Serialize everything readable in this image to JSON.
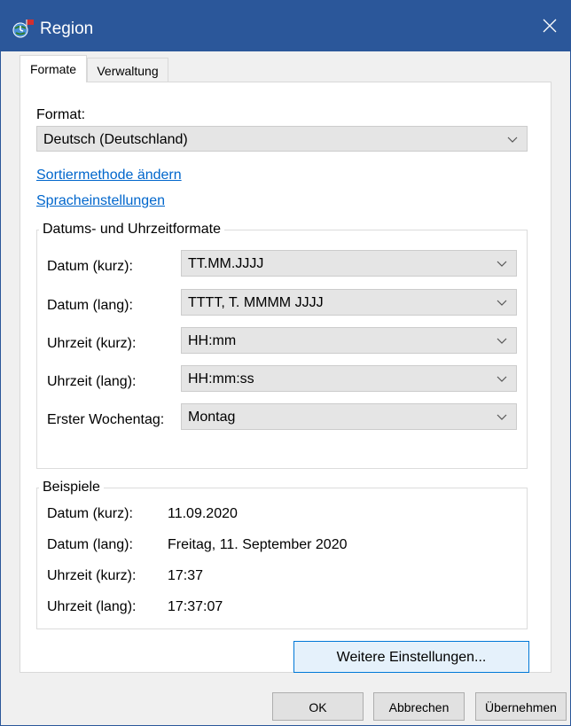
{
  "window": {
    "title": "Region",
    "close_glyph": "✕",
    "icon": "region-globe-icon"
  },
  "tabs": [
    {
      "label": "Formate",
      "active": true
    },
    {
      "label": "Verwaltung",
      "active": false
    }
  ],
  "format": {
    "label": "Format:",
    "selected": "Deutsch (Deutschland)"
  },
  "links": {
    "sort": "Sortiermethode ändern",
    "language": "Spracheinstellungen"
  },
  "datetime_group": {
    "title": "Datums- und Uhrzeitformate",
    "rows": [
      {
        "label": "Datum (kurz):",
        "value": "TT.MM.JJJJ"
      },
      {
        "label": "Datum (lang):",
        "value": "TTTT, T. MMMM JJJJ"
      },
      {
        "label": "Uhrzeit (kurz):",
        "value": "HH:mm"
      },
      {
        "label": "Uhrzeit (lang):",
        "value": "HH:mm:ss"
      },
      {
        "label": "Erster Wochentag:",
        "value": "Montag"
      }
    ]
  },
  "examples_group": {
    "title": "Beispiele",
    "rows": [
      {
        "label": "Datum (kurz):",
        "value": "11.09.2020"
      },
      {
        "label": "Datum (lang):",
        "value": "Freitag, 11. September 2020"
      },
      {
        "label": "Uhrzeit (kurz):",
        "value": "17:37"
      },
      {
        "label": "Uhrzeit (lang):",
        "value": "17:37:07"
      }
    ]
  },
  "buttons": {
    "more_settings": "Weitere Einstellungen...",
    "ok": "OK",
    "cancel": "Abbrechen",
    "apply": "Übernehmen"
  },
  "colors": {
    "titlebar": "#2b579a",
    "link": "#0066cc",
    "primary_border": "#0078d7"
  }
}
